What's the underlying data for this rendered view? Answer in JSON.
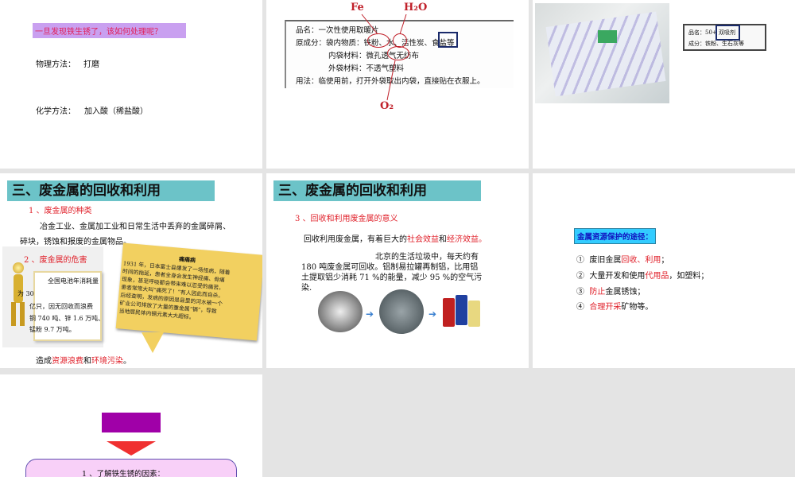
{
  "slides": [
    {
      "question": "一旦发现铁生锈了，该如何处理呢？",
      "physical_label": "物理方法：",
      "physical_value": "打磨",
      "chemical_label": "化学方法：",
      "chemical_value": "加入酸（稀盐酸）"
    },
    {
      "fe": "Fe",
      "h2o": "H₂O",
      "o2": "O₂",
      "lines": [
        "品名：一次性使用取暖片",
        "原成分：袋内物质：铁粉、水、活性炭、食盐等",
        "内袋材料：微孔透气无纺布",
        "外袋材料：不透气塑料",
        "用法：临使用前，打开外袋取出内袋，直接贴在衣服上。"
      ]
    },
    {
      "label_line1": "品名：50+ 双吸剂",
      "label_line2": "成分：铁粉、生石灰等"
    },
    {
      "title": "三、废金属的回收和利用",
      "s1": "1 、废金属的种类",
      "s1_text1": "冶金工业、金属加工业和日常生活中丢弃的金属碎屑、",
      "s1_text2": "碎块，锈蚀和报废的金属物品。",
      "s2": "2 、废金属的危害",
      "board": [
        "全国电池年消耗量",
        "为 30",
        "亿只，因无回收而浪费",
        "铜 740 吨、锌 1.6 万吨、",
        "锰粉 9.7 万吨。"
      ],
      "note_title": "痛痛病",
      "note": [
        "1931 年，日本富士县爆发了一场怪病，随着",
        "时间的拖延，患者全身会发生神经痛、骨痛",
        "现象，甚至呼吸都会带来难以忍受的痛苦。",
        "患者常常大叫“痛死了！”有人因此而自杀。",
        "后经查明，发病的原因是县里的河水被一个",
        "矿业公司排放了大量的重金属“镉”，导致",
        "当地居民体内镉元素大大超标。"
      ],
      "result_prefix": "造成",
      "result_a": "资源浪费",
      "result_mid": "和",
      "result_b": "环境污染",
      "result_end": "。"
    },
    {
      "title": "三、废金属的回收和利用",
      "s3": "3 、回收和利用废金属的意义",
      "intro_prefix": "回收利用废金属，有着巨大的",
      "intro_a": "社会效益",
      "intro_mid": "和",
      "intro_b": "经济效益",
      "intro_end": "。",
      "para": [
        "北京的生活垃圾中，每天约有",
        "180 吨废金属可回收。铝制易拉罐再制铝，比用铝",
        "土提取铝少消耗 71 %的能量，减少 95 %的空气污",
        "染."
      ]
    },
    {
      "heading": "金属资源保护的途径：",
      "items": [
        {
          "n": "①",
          "a": "废旧金属",
          "r": "回收、利用",
          "b": "；"
        },
        {
          "n": "②",
          "a": "大量开发和使用",
          "r": "代用品",
          "b": "，如塑料；"
        },
        {
          "n": "③",
          "a": "",
          "r": "防止",
          "b": "金属锈蚀；"
        },
        {
          "n": "④",
          "a": "",
          "r": "合理开采",
          "b": "矿物等。"
        }
      ]
    },
    {
      "box_text": "1 、了解铁生锈的因素："
    }
  ]
}
